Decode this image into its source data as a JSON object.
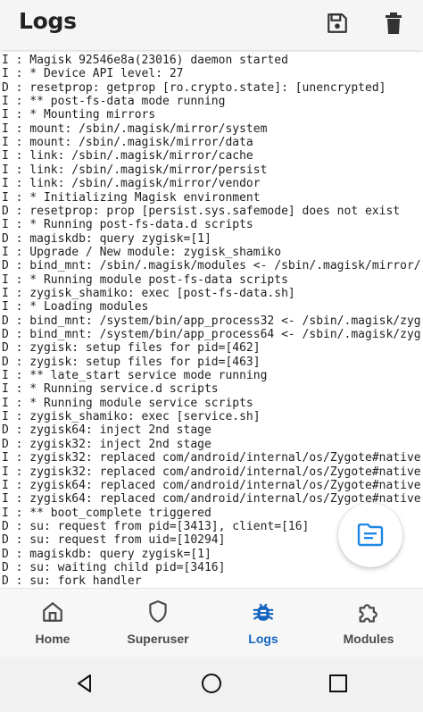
{
  "appbar": {
    "title": "Logs",
    "actions": [
      {
        "name": "save",
        "icon": "save-icon"
      },
      {
        "name": "delete",
        "icon": "trash-icon"
      }
    ]
  },
  "logs": [
    "I : Magisk 92546e8a(23016) daemon started",
    "I : * Device API level: 27",
    "D : resetprop: getprop [ro.crypto.state]: [unencrypted]",
    "I : ** post-fs-data mode running",
    "I : * Mounting mirrors",
    "I : mount: /sbin/.magisk/mirror/system",
    "I : mount: /sbin/.magisk/mirror/data",
    "I : link: /sbin/.magisk/mirror/cache",
    "I : link: /sbin/.magisk/mirror/persist",
    "I : link: /sbin/.magisk/mirror/vendor",
    "I : * Initializing Magisk environment",
    "D : resetprop: prop [persist.sys.safemode] does not exist",
    "I : * Running post-fs-data.d scripts",
    "D : magiskdb: query zygisk=[1]",
    "I : Upgrade / New module: zygisk_shamiko",
    "D : bind_mnt: /sbin/.magisk/modules <- /sbin/.magisk/mirror/",
    "I : * Running module post-fs-data scripts",
    "I : zygisk_shamiko: exec [post-fs-data.sh]",
    "I : * Loading modules",
    "D : bind_mnt: /system/bin/app_process32 <- /sbin/.magisk/zyg",
    "D : bind_mnt: /system/bin/app_process64 <- /sbin/.magisk/zyg",
    "D : zygisk: setup files for pid=[462]",
    "D : zygisk: setup files for pid=[463]",
    "I : ** late_start service mode running",
    "I : * Running service.d scripts",
    "I : * Running module service scripts",
    "I : zygisk_shamiko: exec [service.sh]",
    "D : zygisk64: inject 2nd stage",
    "D : zygisk32: inject 2nd stage",
    "I : zygisk32: replaced com/android/internal/os/Zygote#native",
    "I : zygisk32: replaced com/android/internal/os/Zygote#native",
    "I : zygisk64: replaced com/android/internal/os/Zygote#native",
    "I : zygisk64: replaced com/android/internal/os/Zygote#native",
    "I : ** boot_complete triggered",
    "D : su: request from pid=[3413], client=[16]",
    "D : su: request from uid=[10294]",
    "D : magiskdb: query zygisk=[1]",
    "D : su: waiting child pid=[3416]",
    "D : su: fork handler"
  ],
  "fab": {
    "icon": "log-file-icon"
  },
  "bottom_nav": {
    "items": [
      {
        "id": "home",
        "label": "Home",
        "icon": "home-icon",
        "active": false
      },
      {
        "id": "superuser",
        "label": "Superuser",
        "icon": "shield-icon",
        "active": false
      },
      {
        "id": "logs",
        "label": "Logs",
        "icon": "bug-icon",
        "active": true
      },
      {
        "id": "modules",
        "label": "Modules",
        "icon": "puzzle-icon",
        "active": false
      }
    ]
  },
  "system_nav": {
    "buttons": [
      "back-icon",
      "home-circle-icon",
      "recents-icon"
    ]
  },
  "colors": {
    "accent": "#1565c0",
    "fab_icon": "#1e88e5",
    "inactive": "#4a4a4a",
    "appbar_bg": "#f5f5f5"
  }
}
